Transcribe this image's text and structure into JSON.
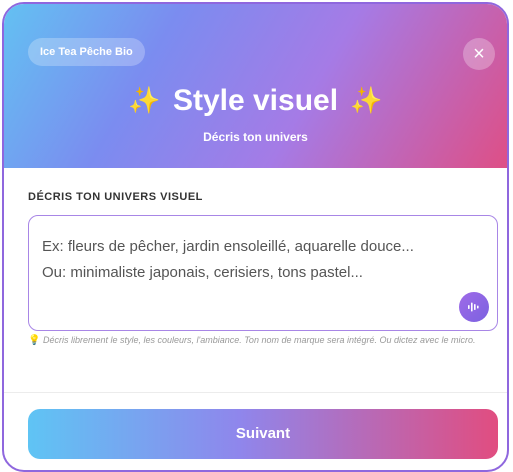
{
  "header": {
    "brand_badge": "Ice Tea Pêche Bio",
    "close_label": "×",
    "title": "Style visuel",
    "sparkle": "✨",
    "subtitle": "Décris ton univers"
  },
  "form": {
    "section_label": "DÉCRIS TON UNIVERS VISUEL",
    "placeholder_line1": "Ex: fleurs de pêcher, jardin ensoleillé, aquarelle douce...",
    "placeholder_line2": "Ou: minimaliste japonais, cerisiers, tons pastel...",
    "hint_icon": "💡",
    "hint": "Décris librement le style, les couleurs, l'ambiance. Ton nom de marque sera intégré. Ou dictez avec le micro."
  },
  "footer": {
    "next_label": "Suivant"
  },
  "icons": {
    "close": "close-icon",
    "sparkle": "sparkle-icon",
    "mic": "microphone-waveform-icon",
    "hint": "lightbulb-icon"
  },
  "colors": {
    "gradient_start": "#63c1f2",
    "gradient_mid": "#a57be6",
    "gradient_end": "#de4f86",
    "border_accent": "#a886e6"
  }
}
